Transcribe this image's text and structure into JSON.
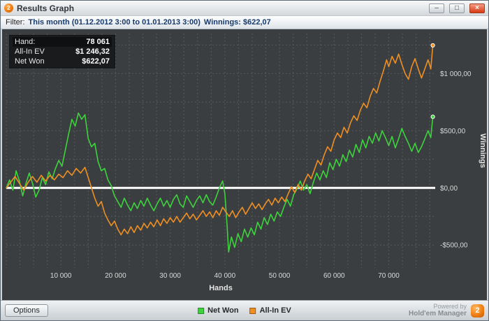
{
  "window": {
    "title": "Results Graph",
    "icon_text": "2",
    "controls": {
      "minimize": "–",
      "maximize": "□",
      "close": "×"
    }
  },
  "filter": {
    "label": "Filter:",
    "range": "This month (01.12.2012 3:00 to 01.01.2013 3:00)",
    "winnings": "Winnings: $622,07"
  },
  "stats_box": {
    "rows": [
      {
        "label": "Hand:",
        "value": "78 061"
      },
      {
        "label": "All-In EV",
        "value": "$1 246,32"
      },
      {
        "label": "Net Won",
        "value": "$622,07"
      }
    ]
  },
  "bottom": {
    "options_label": "Options",
    "legend": [
      {
        "label": "Net Won",
        "color": "#3dd33d"
      },
      {
        "label": "All-In EV",
        "color": "#ef8f22"
      }
    ],
    "powered_by": "Powered by",
    "brand": "Hold'em Manager",
    "logo_text": "2"
  },
  "colors": {
    "chart_bg": "#3b3e40",
    "grid": "#565a5c",
    "zero_line": "#ffffff",
    "axis_text": "#d9d9d9",
    "axis_title": "#e3e3e3",
    "green": "#3dd33d",
    "orange": "#ef8f22"
  },
  "chart_data": {
    "type": "line",
    "title": "",
    "xlabel": "Hands",
    "ylabel": "Winnings",
    "xlim": [
      0,
      78500
    ],
    "ylim": [
      -700,
      1350
    ],
    "x_grid_step": 2500,
    "y_grid_step": 250,
    "grid": true,
    "legend_position": "bottom-center",
    "x_ticks": [
      {
        "value": 10000,
        "label": "10 000"
      },
      {
        "value": 20000,
        "label": "20 000"
      },
      {
        "value": 30000,
        "label": "30 000"
      },
      {
        "value": 40000,
        "label": "40 000"
      },
      {
        "value": 50000,
        "label": "50 000"
      },
      {
        "value": 60000,
        "label": "60 000"
      },
      {
        "value": 70000,
        "label": "70 000"
      }
    ],
    "y_ticks": [
      {
        "value": 1000,
        "label": "$1 000,00"
      },
      {
        "value": 500,
        "label": "$500,00"
      },
      {
        "value": 0,
        "label": "$0,00"
      },
      {
        "value": -500,
        "label": "-$500,00"
      }
    ],
    "series": [
      {
        "name": "Net Won",
        "color": "#3dd33d",
        "final_value": 622.07,
        "points": [
          [
            0,
            0
          ],
          [
            600,
            70
          ],
          [
            1200,
            -20
          ],
          [
            1800,
            150
          ],
          [
            2400,
            60
          ],
          [
            3000,
            -70
          ],
          [
            3600,
            40
          ],
          [
            4200,
            130
          ],
          [
            4800,
            40
          ],
          [
            5400,
            -80
          ],
          [
            6000,
            -20
          ],
          [
            6600,
            90
          ],
          [
            7200,
            30
          ],
          [
            7800,
            140
          ],
          [
            8400,
            80
          ],
          [
            9000,
            170
          ],
          [
            9600,
            240
          ],
          [
            10200,
            190
          ],
          [
            10800,
            330
          ],
          [
            11400,
            470
          ],
          [
            12000,
            600
          ],
          [
            12600,
            540
          ],
          [
            13200,
            655
          ],
          [
            13800,
            600
          ],
          [
            14400,
            640
          ],
          [
            15000,
            430
          ],
          [
            15600,
            360
          ],
          [
            16200,
            390
          ],
          [
            16800,
            230
          ],
          [
            17400,
            150
          ],
          [
            18000,
            170
          ],
          [
            18600,
            70
          ],
          [
            19200,
            20
          ],
          [
            19800,
            -70
          ],
          [
            20400,
            -120
          ],
          [
            21000,
            -170
          ],
          [
            21600,
            -90
          ],
          [
            22200,
            -150
          ],
          [
            22800,
            -200
          ],
          [
            23400,
            -130
          ],
          [
            24000,
            -180
          ],
          [
            24600,
            -110
          ],
          [
            25200,
            -160
          ],
          [
            25800,
            -90
          ],
          [
            26400,
            -150
          ],
          [
            27000,
            -200
          ],
          [
            27600,
            -140
          ],
          [
            28200,
            -90
          ],
          [
            28800,
            -160
          ],
          [
            29400,
            -110
          ],
          [
            30000,
            -170
          ],
          [
            30600,
            -100
          ],
          [
            31200,
            -60
          ],
          [
            31800,
            -140
          ],
          [
            32400,
            -170
          ],
          [
            33000,
            -70
          ],
          [
            33600,
            -120
          ],
          [
            34200,
            -170
          ],
          [
            34800,
            -110
          ],
          [
            35400,
            -70
          ],
          [
            36000,
            -130
          ],
          [
            36600,
            -60
          ],
          [
            37200,
            -120
          ],
          [
            37800,
            -150
          ],
          [
            38400,
            -80
          ],
          [
            39000,
            0
          ],
          [
            39600,
            60
          ],
          [
            40000,
            -50
          ],
          [
            40400,
            -320
          ],
          [
            40700,
            -560
          ],
          [
            41200,
            -430
          ],
          [
            41800,
            -520
          ],
          [
            42400,
            -400
          ],
          [
            43000,
            -470
          ],
          [
            43600,
            -360
          ],
          [
            44200,
            -430
          ],
          [
            44800,
            -350
          ],
          [
            45400,
            -410
          ],
          [
            46000,
            -300
          ],
          [
            46600,
            -360
          ],
          [
            47200,
            -260
          ],
          [
            47800,
            -320
          ],
          [
            48400,
            -230
          ],
          [
            49000,
            -290
          ],
          [
            49600,
            -210
          ],
          [
            50200,
            -250
          ],
          [
            50800,
            -170
          ],
          [
            51400,
            -100
          ],
          [
            52000,
            -160
          ],
          [
            52600,
            -60
          ],
          [
            53200,
            -10
          ],
          [
            53800,
            60
          ],
          [
            54400,
            -20
          ],
          [
            55000,
            30
          ],
          [
            55600,
            -50
          ],
          [
            56200,
            50
          ],
          [
            56800,
            130
          ],
          [
            57400,
            70
          ],
          [
            58000,
            150
          ],
          [
            58600,
            90
          ],
          [
            59200,
            220
          ],
          [
            59800,
            160
          ],
          [
            60400,
            250
          ],
          [
            61000,
            190
          ],
          [
            61600,
            290
          ],
          [
            62200,
            230
          ],
          [
            62800,
            330
          ],
          [
            63400,
            270
          ],
          [
            64000,
            380
          ],
          [
            64600,
            310
          ],
          [
            65200,
            420
          ],
          [
            65800,
            350
          ],
          [
            66400,
            450
          ],
          [
            67000,
            390
          ],
          [
            67600,
            480
          ],
          [
            68200,
            410
          ],
          [
            68800,
            500
          ],
          [
            69400,
            440
          ],
          [
            70000,
            370
          ],
          [
            70600,
            450
          ],
          [
            71200,
            350
          ],
          [
            71800,
            430
          ],
          [
            72400,
            520
          ],
          [
            73000,
            450
          ],
          [
            73600,
            390
          ],
          [
            74200,
            320
          ],
          [
            74800,
            390
          ],
          [
            75400,
            310
          ],
          [
            76000,
            360
          ],
          [
            76600,
            430
          ],
          [
            77200,
            500
          ],
          [
            77700,
            440
          ],
          [
            78061,
            622
          ]
        ]
      },
      {
        "name": "All-In EV",
        "color": "#ef8f22",
        "final_value": 1246.32,
        "points": [
          [
            0,
            0
          ],
          [
            800,
            50
          ],
          [
            1600,
            100
          ],
          [
            2400,
            40
          ],
          [
            3200,
            -20
          ],
          [
            4000,
            50
          ],
          [
            4800,
            100
          ],
          [
            5600,
            50
          ],
          [
            6400,
            110
          ],
          [
            7200,
            60
          ],
          [
            8000,
            110
          ],
          [
            8800,
            70
          ],
          [
            9600,
            120
          ],
          [
            10400,
            90
          ],
          [
            11200,
            150
          ],
          [
            12000,
            110
          ],
          [
            12800,
            170
          ],
          [
            13600,
            130
          ],
          [
            14400,
            180
          ],
          [
            15000,
            90
          ],
          [
            15600,
            0
          ],
          [
            16200,
            -90
          ],
          [
            16800,
            -160
          ],
          [
            17400,
            -120
          ],
          [
            18000,
            -220
          ],
          [
            18600,
            -280
          ],
          [
            19200,
            -330
          ],
          [
            19800,
            -290
          ],
          [
            20400,
            -360
          ],
          [
            21000,
            -410
          ],
          [
            21600,
            -360
          ],
          [
            22200,
            -400
          ],
          [
            22800,
            -340
          ],
          [
            23400,
            -390
          ],
          [
            24000,
            -330
          ],
          [
            24600,
            -370
          ],
          [
            25200,
            -310
          ],
          [
            25800,
            -350
          ],
          [
            26400,
            -300
          ],
          [
            27000,
            -340
          ],
          [
            27600,
            -280
          ],
          [
            28200,
            -330
          ],
          [
            28800,
            -270
          ],
          [
            29400,
            -310
          ],
          [
            30000,
            -260
          ],
          [
            30600,
            -300
          ],
          [
            31200,
            -250
          ],
          [
            31800,
            -300
          ],
          [
            32400,
            -260
          ],
          [
            33000,
            -220
          ],
          [
            33600,
            -270
          ],
          [
            34200,
            -230
          ],
          [
            34800,
            -280
          ],
          [
            35400,
            -240
          ],
          [
            36000,
            -200
          ],
          [
            36600,
            -250
          ],
          [
            37200,
            -210
          ],
          [
            37800,
            -260
          ],
          [
            38400,
            -200
          ],
          [
            39000,
            -240
          ],
          [
            39600,
            -170
          ],
          [
            40200,
            -210
          ],
          [
            40800,
            -250
          ],
          [
            41400,
            -200
          ],
          [
            42000,
            -260
          ],
          [
            42600,
            -210
          ],
          [
            43200,
            -170
          ],
          [
            43800,
            -230
          ],
          [
            44400,
            -180
          ],
          [
            45000,
            -130
          ],
          [
            45600,
            -180
          ],
          [
            46200,
            -140
          ],
          [
            46800,
            -190
          ],
          [
            47400,
            -140
          ],
          [
            48000,
            -100
          ],
          [
            48600,
            -150
          ],
          [
            49200,
            -90
          ],
          [
            49800,
            -130
          ],
          [
            50400,
            -80
          ],
          [
            51000,
            -120
          ],
          [
            51600,
            -50
          ],
          [
            52200,
            10
          ],
          [
            52800,
            -40
          ],
          [
            53400,
            30
          ],
          [
            54000,
            -20
          ],
          [
            54600,
            60
          ],
          [
            55200,
            120
          ],
          [
            55800,
            80
          ],
          [
            56400,
            160
          ],
          [
            57000,
            240
          ],
          [
            57600,
            200
          ],
          [
            58200,
            290
          ],
          [
            58800,
            360
          ],
          [
            59400,
            320
          ],
          [
            60000,
            420
          ],
          [
            60600,
            480
          ],
          [
            61200,
            440
          ],
          [
            61800,
            530
          ],
          [
            62400,
            480
          ],
          [
            63000,
            570
          ],
          [
            63600,
            630
          ],
          [
            64200,
            590
          ],
          [
            64800,
            680
          ],
          [
            65400,
            740
          ],
          [
            66000,
            700
          ],
          [
            66600,
            800
          ],
          [
            67200,
            870
          ],
          [
            67800,
            830
          ],
          [
            68400,
            930
          ],
          [
            69000,
            1020
          ],
          [
            69600,
            1120
          ],
          [
            70000,
            1060
          ],
          [
            70600,
            1150
          ],
          [
            71200,
            1090
          ],
          [
            71800,
            1170
          ],
          [
            72400,
            1080
          ],
          [
            73000,
            1000
          ],
          [
            73600,
            950
          ],
          [
            74200,
            1060
          ],
          [
            74800,
            1130
          ],
          [
            75400,
            1040
          ],
          [
            76000,
            960
          ],
          [
            76600,
            1040
          ],
          [
            77200,
            1120
          ],
          [
            77700,
            1040
          ],
          [
            78061,
            1246
          ]
        ]
      }
    ]
  }
}
